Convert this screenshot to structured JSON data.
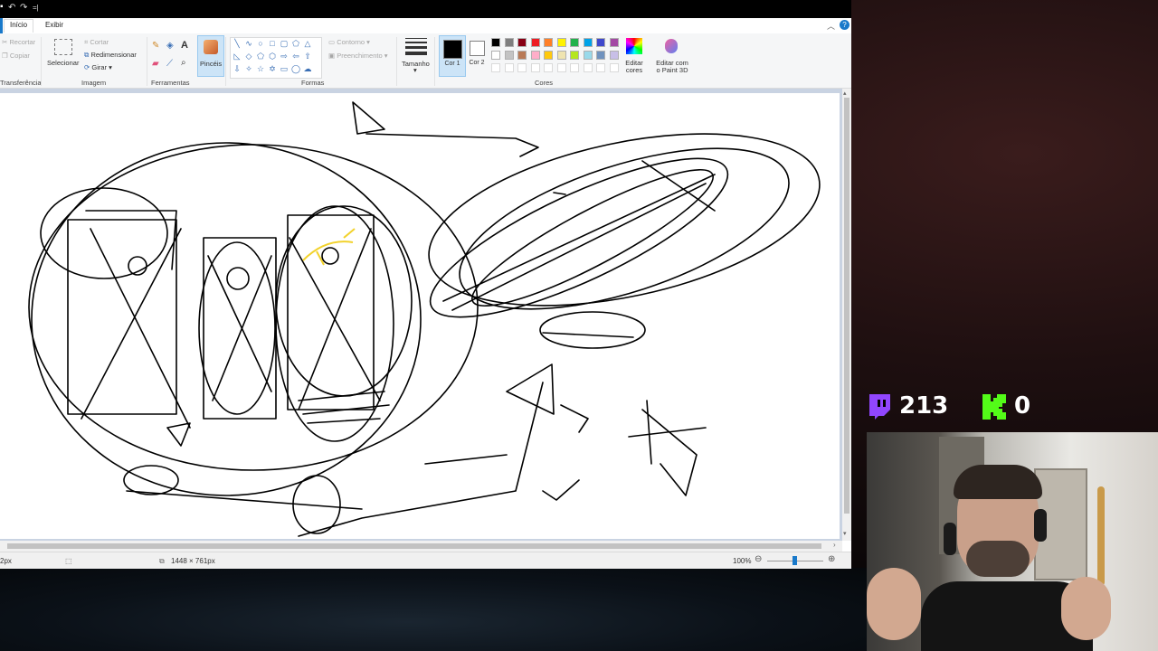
{
  "paint": {
    "tabs": [
      "Início",
      "Exibir"
    ],
    "clipboard": {
      "cut": "Recortar",
      "copy": "Copiar",
      "label": "Transferência"
    },
    "image": {
      "select": "Selecionar",
      "crop": "Cortar",
      "resize": "Redimensionar",
      "rotate": "Girar",
      "label": "Imagem"
    },
    "tools": {
      "label": "Ferramentas"
    },
    "brushes": {
      "label": "Pincéis"
    },
    "shapes": {
      "outline": "Contorno",
      "fill": "Preenchimento",
      "label": "Formas"
    },
    "size": {
      "label": "Tamanho"
    },
    "colors": {
      "color1": "Cor 1",
      "color2": "Cor 2",
      "edit": "Editar cores",
      "paint3d": "Editar com o Paint 3D",
      "label": "Cores",
      "row1": [
        "#000000",
        "#7f7f7f",
        "#880015",
        "#ed1c24",
        "#ff7f27",
        "#fff200",
        "#22b14c",
        "#00a2e8",
        "#3f48cc",
        "#a349a4"
      ],
      "row2": [
        "#ffffff",
        "#c3c3c3",
        "#b97a57",
        "#ffaec9",
        "#ffc90e",
        "#efe4b0",
        "#b5e61d",
        "#99d9ea",
        "#7092be",
        "#c8bfe7"
      ]
    },
    "status": {
      "brush_size": "2px",
      "dimensions": "1448 × 761px",
      "zoom": "100%"
    }
  },
  "overlay": {
    "viewers": "213",
    "kick_viewers": "0"
  }
}
